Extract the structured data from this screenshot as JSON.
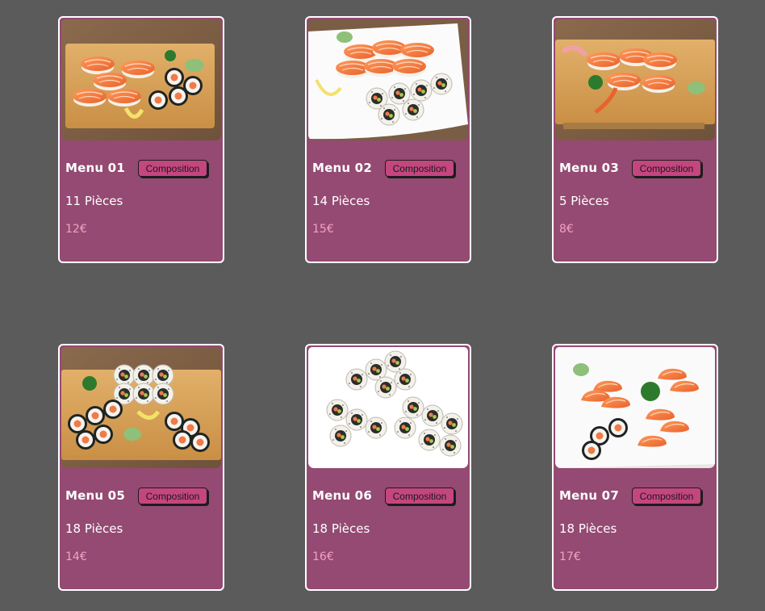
{
  "colors": {
    "page_background": "#5b5b5b",
    "card_background": "#944a72",
    "card_border": "#ffffff",
    "button_background": "#c4467f",
    "price_color": "#f3a1c0"
  },
  "menus": [
    {
      "name": "Menu 01",
      "button_label": "Composition",
      "pieces": "11 Pièces",
      "price": "12€",
      "photo": "sushi-board-photo"
    },
    {
      "name": "Menu 02",
      "button_label": "Composition",
      "pieces": "14 Pièces",
      "price": "15€",
      "photo": "sushi-plate-photo"
    },
    {
      "name": "Menu 03",
      "button_label": "Composition",
      "pieces": "5 Pièces",
      "price": "8€",
      "photo": "sushi-board-photo"
    },
    {
      "name": "Menu 05",
      "button_label": "Composition",
      "pieces": "18 Pièces",
      "price": "14€",
      "photo": "maki-board-photo"
    },
    {
      "name": "Menu 06",
      "button_label": "Composition",
      "pieces": "18 Pièces",
      "price": "16€",
      "photo": "california-rolls-photo"
    },
    {
      "name": "Menu 07",
      "button_label": "Composition",
      "pieces": "18 Pièces",
      "price": "17€",
      "photo": "sashimi-plate-photo"
    }
  ]
}
